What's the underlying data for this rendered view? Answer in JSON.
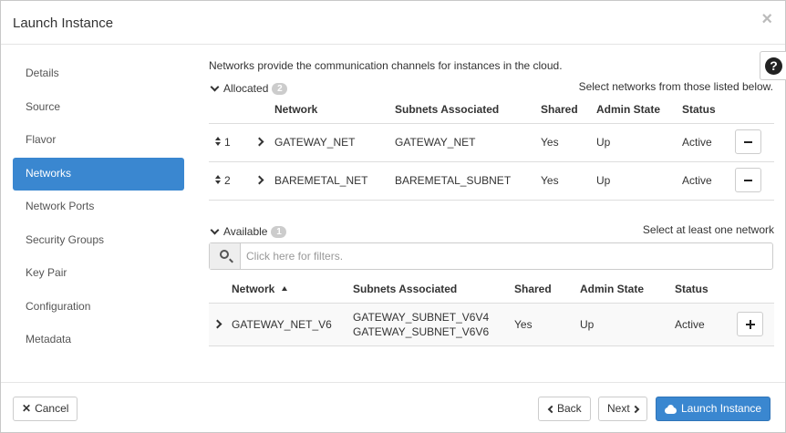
{
  "modal": {
    "title": "Launch Instance",
    "close_glyph": "×"
  },
  "sidebar": {
    "items": [
      {
        "label": "Details"
      },
      {
        "label": "Source"
      },
      {
        "label": "Flavor"
      },
      {
        "label": "Networks",
        "active": true
      },
      {
        "label": "Network Ports"
      },
      {
        "label": "Security Groups"
      },
      {
        "label": "Key Pair"
      },
      {
        "label": "Configuration"
      },
      {
        "label": "Metadata"
      }
    ]
  },
  "help": {
    "glyph": "?"
  },
  "intro": "Networks provide the communication channels for instances in the cloud.",
  "allocated": {
    "label": "Allocated",
    "count": "2",
    "hint": "Select networks from those listed below.",
    "columns": [
      "Network",
      "Subnets Associated",
      "Shared",
      "Admin State",
      "Status"
    ],
    "rows": [
      {
        "index": "1",
        "network": "GATEWAY_NET",
        "subnets": "GATEWAY_NET",
        "shared": "Yes",
        "admin_state": "Up",
        "status": "Active"
      },
      {
        "index": "2",
        "network": "BAREMETAL_NET",
        "subnets": "BAREMETAL_SUBNET",
        "shared": "Yes",
        "admin_state": "Up",
        "status": "Active"
      }
    ]
  },
  "available": {
    "label": "Available",
    "count": "1",
    "hint": "Select at least one network",
    "filter_placeholder": "Click here for filters.",
    "columns": [
      "Network",
      "Subnets Associated",
      "Shared",
      "Admin State",
      "Status"
    ],
    "rows": [
      {
        "network": "GATEWAY_NET_V6",
        "subnets": [
          "GATEWAY_SUBNET_V6V4",
          "GATEWAY_SUBNET_V6V6"
        ],
        "shared": "Yes",
        "admin_state": "Up",
        "status": "Active"
      }
    ]
  },
  "footer": {
    "cancel": "Cancel",
    "back": "Back",
    "next": "Next",
    "launch": "Launch Instance"
  },
  "colors": {
    "accent": "#3a87d0",
    "badge": "#cccccc"
  }
}
